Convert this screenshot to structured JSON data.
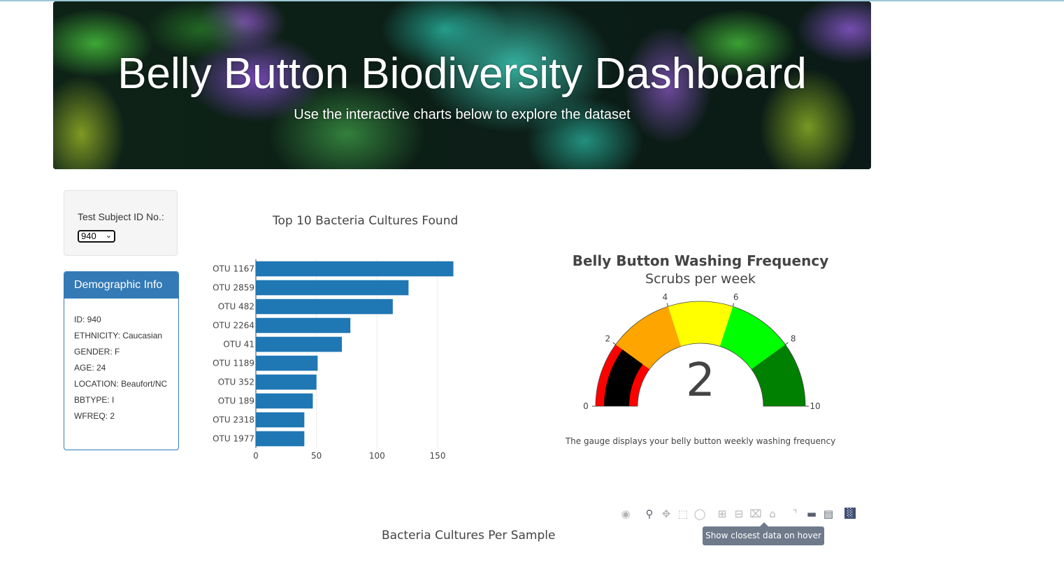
{
  "header": {
    "title": "Belly Button Biodiversity Dashboard",
    "subtitle": "Use the interactive charts below to explore the dataset"
  },
  "selector": {
    "label": "Test Subject ID No.:",
    "value": "940",
    "chevron": "v"
  },
  "demographics": {
    "heading": "Demographic Info",
    "rows": [
      "ID: 940",
      "ETHNICITY: Caucasian",
      "GENDER: F",
      "AGE: 24",
      "LOCATION: Beaufort/NC",
      "BBTYPE: I",
      "WFREQ: 2"
    ]
  },
  "bar_chart": {
    "title": "Top 10 Bacteria Cultures Found"
  },
  "gauge": {
    "title": "Belly Button Washing Frequency",
    "subtitle": "Scrubs per week",
    "value_text": "2",
    "note": "The gauge displays your belly button weekly washing frequency"
  },
  "modebar": {
    "tooltip": "Show closest data on hover",
    "icons": [
      "camera-icon",
      "zoom-icon",
      "pan-icon",
      "box-select-icon",
      "lasso-icon",
      "zoom-in-icon",
      "zoom-out-icon",
      "autoscale-icon",
      "reset-axes-icon",
      "spike-lines-icon",
      "hover-closest-icon",
      "hover-compare-icon",
      "plotly-logo-icon"
    ]
  },
  "bubble_chart": {
    "title": "Bacteria Cultures Per Sample"
  },
  "chart_data": [
    {
      "type": "bar",
      "orientation": "horizontal",
      "title": "Top 10 Bacteria Cultures Found",
      "categories": [
        "OTU 1167",
        "OTU 2859",
        "OTU 482",
        "OTU 2264",
        "OTU 41",
        "OTU 1189",
        "OTU 352",
        "OTU 189",
        "OTU 2318",
        "OTU 1977"
      ],
      "values": [
        163,
        126,
        113,
        78,
        71,
        51,
        50,
        47,
        40,
        40
      ],
      "xlim": [
        0,
        165
      ],
      "xticks": [
        0,
        50,
        100,
        150
      ],
      "color": "#1f77b4",
      "grid": true
    },
    {
      "type": "gauge",
      "title": "Belly Button Washing Frequency",
      "subtitle": "Scrubs per week",
      "value": 2,
      "range": [
        0,
        10
      ],
      "ticks": [
        0,
        2,
        4,
        6,
        8,
        10
      ],
      "steps": [
        {
          "range": [
            0,
            2
          ],
          "color": "#ff0000"
        },
        {
          "range": [
            2,
            4
          ],
          "color": "#ffa500"
        },
        {
          "range": [
            4,
            6
          ],
          "color": "#ffff00"
        },
        {
          "range": [
            6,
            8
          ],
          "color": "#00ff00"
        },
        {
          "range": [
            8,
            10
          ],
          "color": "#008000"
        }
      ],
      "bar_color": "#000000"
    }
  ]
}
